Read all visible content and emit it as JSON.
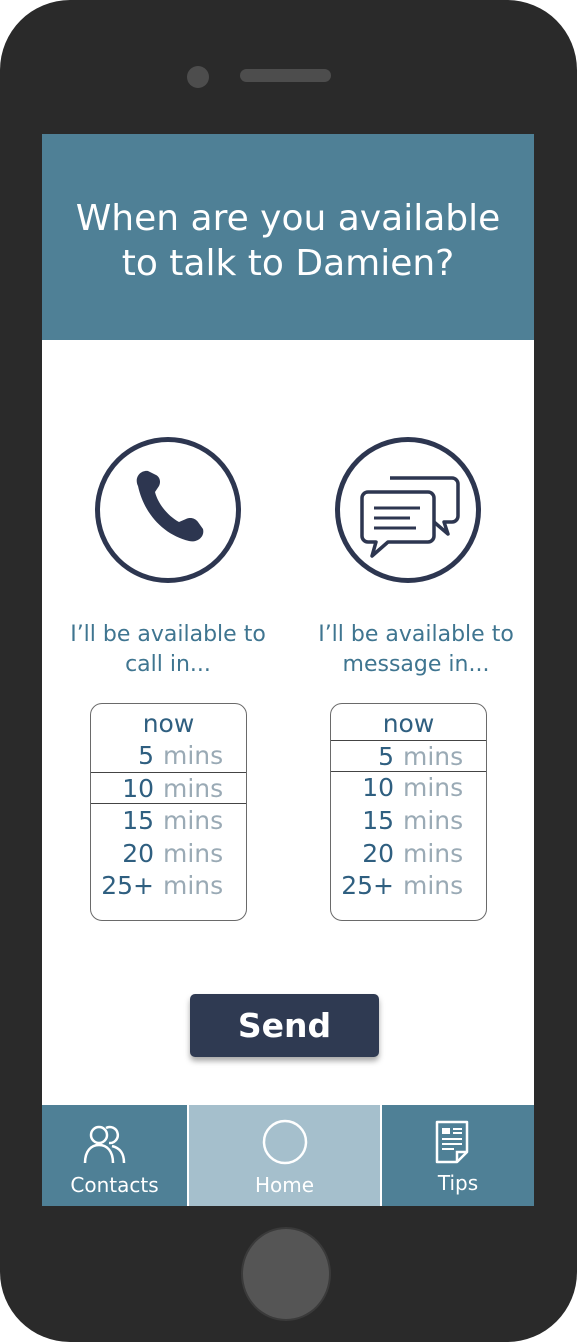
{
  "header": {
    "title_line1": "When are you available",
    "title_line2": "to talk to Damien?"
  },
  "call": {
    "icon": "phone-icon",
    "label_line1": "I’ll be available to",
    "label_line2": "call in...",
    "selected": "10 mins",
    "options": [
      {
        "num": "now",
        "unit": ""
      },
      {
        "num": "5",
        "unit": "mins"
      },
      {
        "num": "10",
        "unit": "mins"
      },
      {
        "num": "15",
        "unit": "mins"
      },
      {
        "num": "20",
        "unit": "mins"
      },
      {
        "num": "25+",
        "unit": "mins"
      }
    ]
  },
  "message": {
    "icon": "chat-bubbles-icon",
    "label_line1": "I’ll be available to",
    "label_line2": "message in...",
    "selected": "5 mins",
    "options": [
      {
        "num": "now",
        "unit": ""
      },
      {
        "num": "5",
        "unit": "mins"
      },
      {
        "num": "10",
        "unit": "mins"
      },
      {
        "num": "15",
        "unit": "mins"
      },
      {
        "num": "20",
        "unit": "mins"
      },
      {
        "num": "25+",
        "unit": "mins"
      }
    ]
  },
  "send_label": "Send",
  "tabs": [
    {
      "label": "Contacts",
      "icon": "people-icon"
    },
    {
      "label": "Home",
      "icon": "circle-icon",
      "active": true
    },
    {
      "label": "Tips",
      "icon": "document-icon"
    }
  ],
  "colors": {
    "header": "#4f8096",
    "tab_active": "#a5bfcc",
    "button": "#2f3a52",
    "icon_stroke": "#2d3650",
    "text_blue": "#3f7590"
  }
}
